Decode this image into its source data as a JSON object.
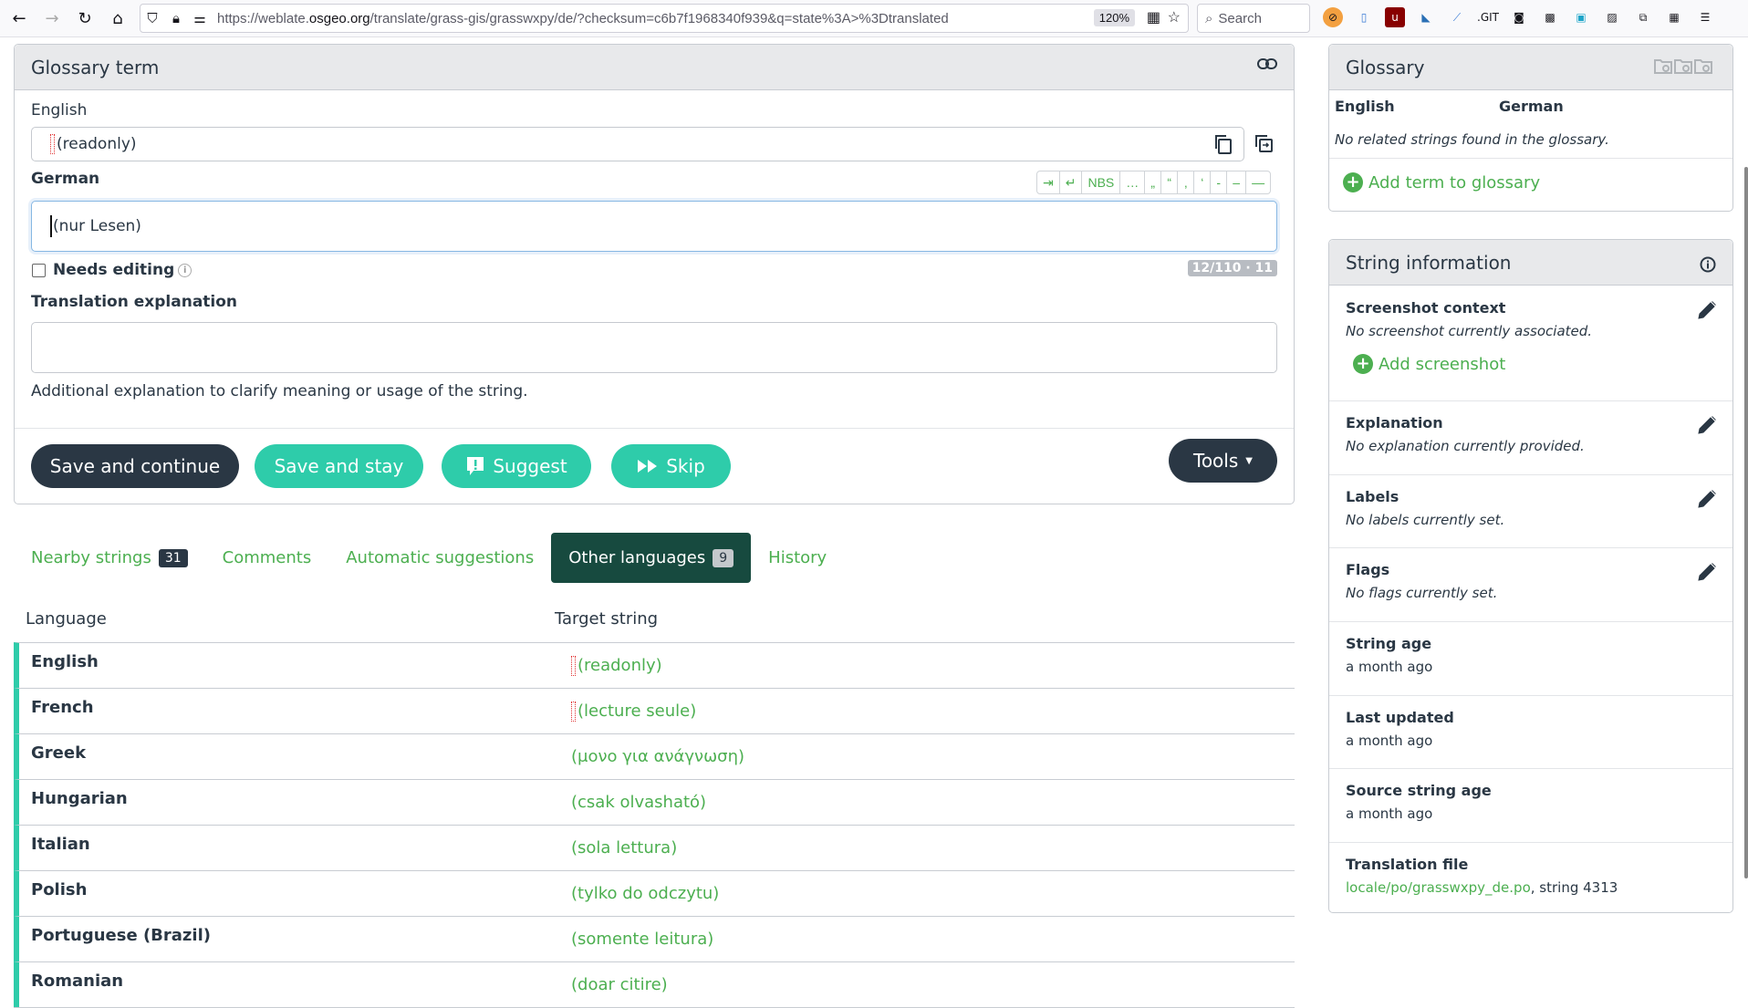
{
  "browser": {
    "url_prefix": "https://weblate.",
    "url_domain": "osgeo.org",
    "url_rest": "/translate/grass-gis/grasswxpy/de/?checksum=c6b7f1968340f939&q=state%3A>%3Dtranslated",
    "zoom": "120%",
    "search_placeholder": "Search"
  },
  "editor": {
    "title": "Glossary term",
    "source_lang": "English",
    "source_text": "(readonly)",
    "target_lang": "German",
    "target_text": "(nur Lesen)",
    "special_chars": [
      "⇥",
      "↵",
      "NBS",
      "…",
      "„",
      "“",
      "‚",
      "‘",
      "-",
      "–",
      "—"
    ],
    "needs_editing_label": "Needs editing",
    "needs_editing_checked": false,
    "counter": "12/110 · 11",
    "explanation_label": "Translation explanation",
    "explanation_value": "",
    "explanation_help": "Additional explanation to clarify meaning or usage of the string.",
    "buttons": {
      "save_continue": "Save and continue",
      "save_stay": "Save and stay",
      "suggest": "Suggest",
      "skip": "Skip",
      "tools": "Tools"
    }
  },
  "tabs": [
    {
      "label": "Nearby strings",
      "badge": "31",
      "active": false
    },
    {
      "label": "Comments",
      "badge": null,
      "active": false
    },
    {
      "label": "Automatic suggestions",
      "badge": null,
      "active": false
    },
    {
      "label": "Other languages",
      "badge": "9",
      "active": true
    },
    {
      "label": "History",
      "badge": null,
      "active": false
    }
  ],
  "other_languages": {
    "col_language": "Language",
    "col_target": "Target string",
    "rows": [
      {
        "language": "English",
        "target": "(readonly)",
        "leading_ws": true
      },
      {
        "language": "French",
        "target": "(lecture seule)",
        "leading_ws": true
      },
      {
        "language": "Greek",
        "target": "(μονο για ανάγνωση)",
        "leading_ws": false
      },
      {
        "language": "Hungarian",
        "target": "(csak olvasható)",
        "leading_ws": false
      },
      {
        "language": "Italian",
        "target": "(sola lettura)",
        "leading_ws": false
      },
      {
        "language": "Polish",
        "target": "(tylko do odczytu)",
        "leading_ws": false
      },
      {
        "language": "Portuguese (Brazil)",
        "target": "(somente leitura)",
        "leading_ws": false
      },
      {
        "language": "Romanian",
        "target": "(doar citire)",
        "leading_ws": false
      }
    ]
  },
  "glossary": {
    "title": "Glossary",
    "col_source": "English",
    "col_target": "German",
    "empty_note": "No related strings found in the glossary.",
    "add_label": "Add term to glossary"
  },
  "string_info": {
    "title": "String information",
    "screenshot": {
      "title": "Screenshot context",
      "value": "No screenshot currently associated.",
      "add_label": "Add screenshot"
    },
    "explanation": {
      "title": "Explanation",
      "value": "No explanation currently provided."
    },
    "labels": {
      "title": "Labels",
      "value": "No labels currently set."
    },
    "flags": {
      "title": "Flags",
      "value": "No flags currently set."
    },
    "string_age": {
      "title": "String age",
      "value": "a month ago"
    },
    "last_updated": {
      "title": "Last updated",
      "value": "a month ago"
    },
    "source_age": {
      "title": "Source string age",
      "value": "a month ago"
    },
    "translation_file": {
      "title": "Translation file",
      "link": "locale/po/grasswxpy_de.po",
      "suffix": ", string 4313"
    }
  }
}
